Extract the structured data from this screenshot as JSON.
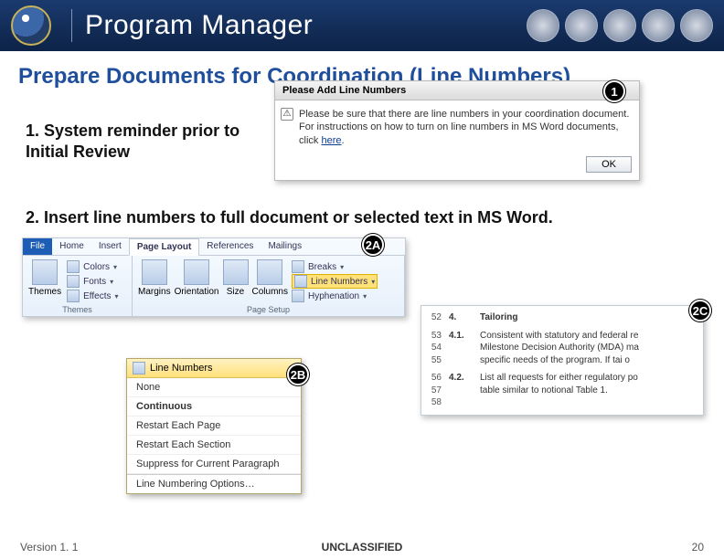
{
  "header": {
    "title": "Program Manager"
  },
  "section_title": "Prepare Documents for Coordination (Line Numbers)",
  "steps": {
    "s1": "1.  System reminder prior to Initial Review",
    "s2": "2.  Insert line numbers to full document or selected text in MS Word."
  },
  "dialog": {
    "title": "Please Add Line Numbers",
    "body_pre": "Please be sure that there are line numbers in your coordination document. For instructions on how to turn on line numbers in MS Word documents, click ",
    "here": "here",
    "body_post": ".",
    "ok": "OK"
  },
  "badges": {
    "b1": "1",
    "b2a": "2A",
    "b2b": "2B",
    "b2c": "2C"
  },
  "ribbon": {
    "tabs": [
      "File",
      "Home",
      "Insert",
      "Page Layout",
      "References",
      "Mailings"
    ],
    "active_idx": 3,
    "themes": {
      "big": "Themes",
      "items": [
        "Colors",
        "Fonts",
        "Effects"
      ],
      "label": "Themes"
    },
    "pagesetup": {
      "big": [
        "Margins",
        "Orientation",
        "Size",
        "Columns"
      ],
      "side": [
        "Breaks",
        "Line Numbers",
        "Hyphenation"
      ],
      "highlight_idx": 1,
      "label": "Page Setup"
    }
  },
  "dropdown": {
    "header": "Line Numbers",
    "items": [
      "None",
      "Continuous",
      "Restart Each Page",
      "Restart Each Section",
      "Suppress for Current Paragraph",
      "Line Numbering Options…"
    ],
    "highlight_idx": 1
  },
  "sample": {
    "rows": [
      {
        "ln": "52",
        "num": "4.",
        "title": "Tailoring"
      },
      {
        "ln": "53",
        "num": "4.1.",
        "title": "Consistent with statutory and federal re"
      },
      {
        "ln": "54",
        "num": "",
        "title": "Milestone Decision Authority (MDA) ma"
      },
      {
        "ln": "55",
        "num": "",
        "title": "specific needs of the program.  If tai o"
      },
      {
        "ln": "56",
        "num": "4.2.",
        "title": "List all requests for either regulatory po"
      },
      {
        "ln": "57",
        "num": "",
        "title": "table similar to notional Table 1."
      },
      {
        "ln": "58",
        "num": "",
        "title": ""
      }
    ]
  },
  "footer": {
    "version": "Version 1. 1",
    "class": "UNCLASSIFIED",
    "page": "20"
  }
}
